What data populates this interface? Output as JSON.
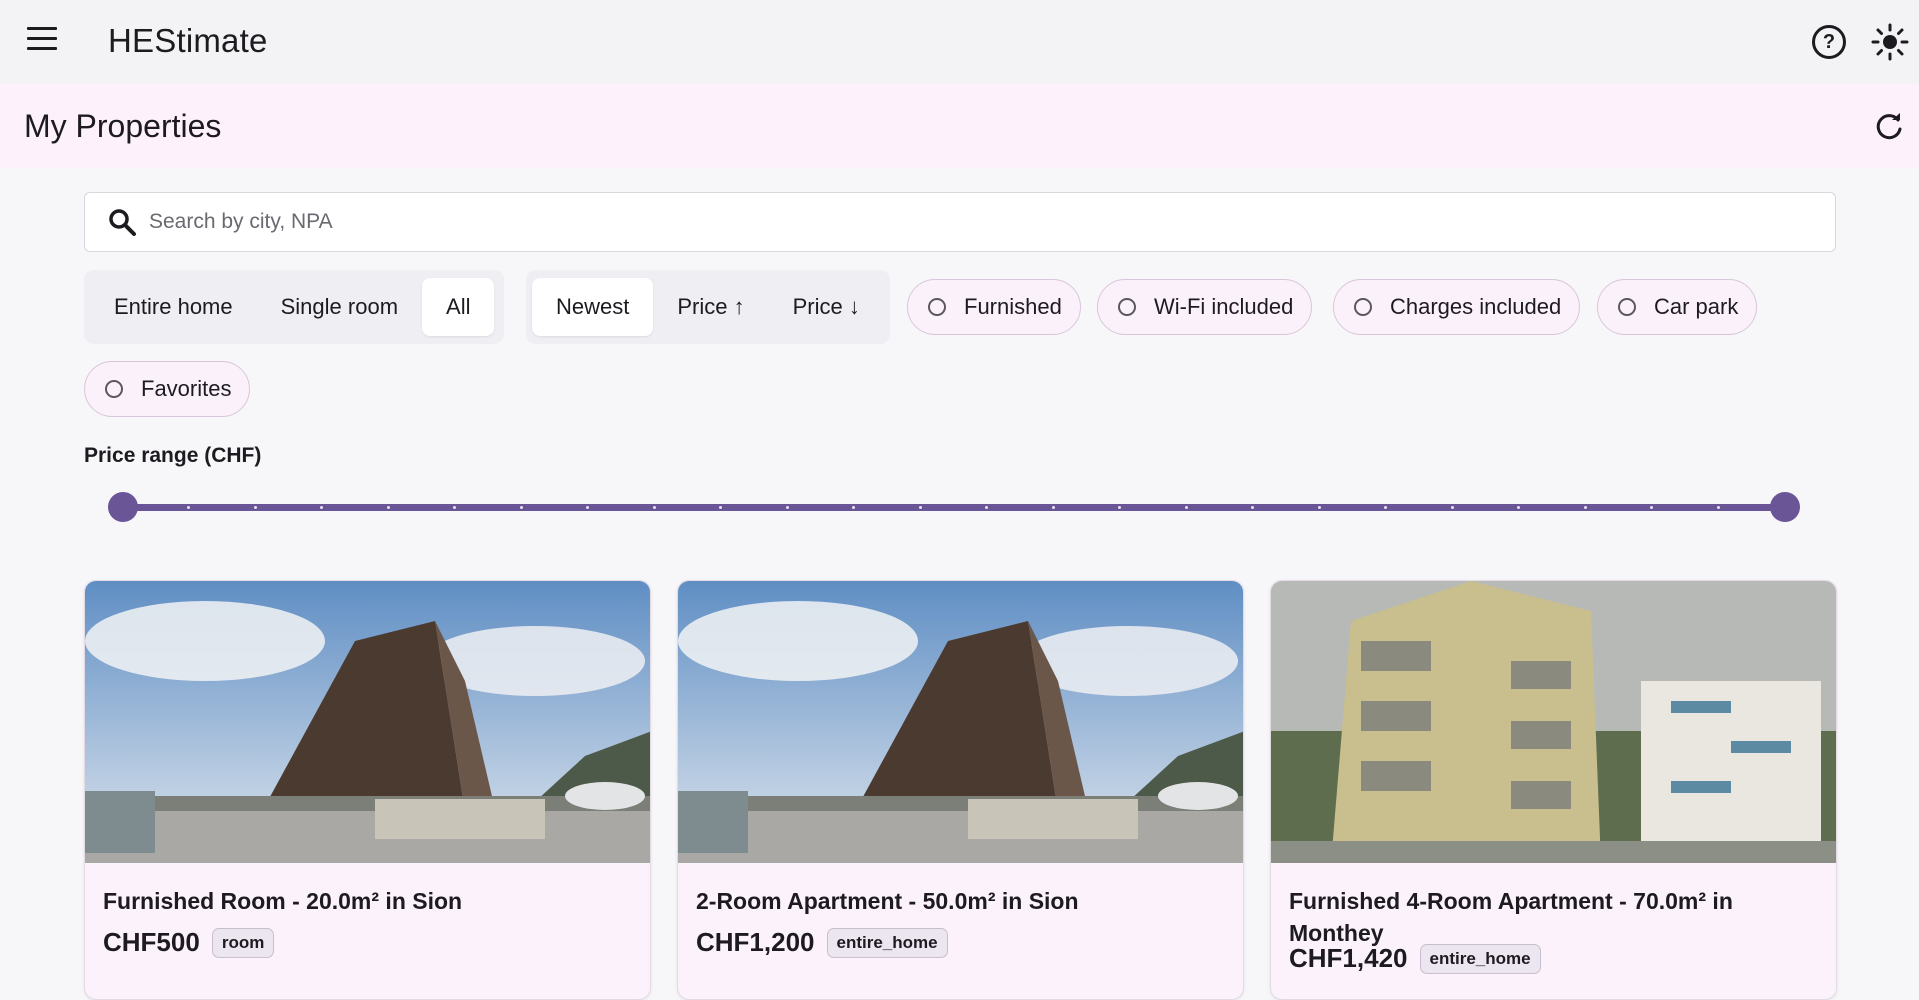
{
  "app": {
    "title": "HEStimate"
  },
  "header": {
    "page_title": "My Properties"
  },
  "search": {
    "placeholder": "Search by city, NPA",
    "value": ""
  },
  "filters": {
    "type_segments": [
      {
        "label": "Entire home",
        "active": false
      },
      {
        "label": "Single room",
        "active": false
      },
      {
        "label": "All",
        "active": true
      }
    ],
    "sort_segments": [
      {
        "label": "Newest",
        "active": true
      },
      {
        "label": "Price ↑",
        "active": false
      },
      {
        "label": "Price ↓",
        "active": false
      }
    ],
    "chips": [
      {
        "label": "Furnished",
        "selected": false
      },
      {
        "label": "Wi-Fi included",
        "selected": false
      },
      {
        "label": "Charges included",
        "selected": false
      },
      {
        "label": "Car park",
        "selected": false
      },
      {
        "label": "Favorites",
        "selected": false
      }
    ]
  },
  "price_range": {
    "label": "Price range (CHF)",
    "low_fraction": 0.0,
    "high_fraction": 1.0
  },
  "listings": [
    {
      "title": "Furnished Room - 20.0m² in Sion",
      "price": "CHF500",
      "tag": "room"
    },
    {
      "title": "2-Room Apartment - 50.0m² in Sion",
      "price": "CHF1,200",
      "tag": "entire_home"
    },
    {
      "title": "Furnished 4-Room Apartment - 70.0m² in Monthey",
      "price": "CHF1,420",
      "tag": "entire_home"
    }
  ],
  "colors": {
    "accent": "#6a5596",
    "header_bg": "#fdf1fb",
    "card_bg": "#fbf2fb"
  }
}
